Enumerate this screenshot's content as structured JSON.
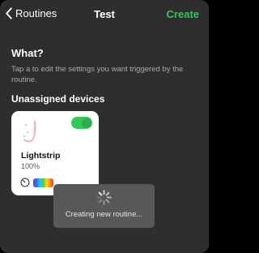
{
  "header": {
    "back_label": "Routines",
    "title": "Test",
    "create_label": "Create"
  },
  "what_section": {
    "heading": "What?",
    "description": "Tap a to edit the settings you want triggered by the routine."
  },
  "unassigned_section": {
    "heading": "Unassigned devices",
    "devices": [
      {
        "name": "Lightstrip",
        "level": "100%",
        "enabled": true,
        "icon": "lightstrip-icon"
      }
    ]
  },
  "overlay": {
    "message": "Creating new routine...",
    "icon": "spinner-icon"
  },
  "colors": {
    "accent": "#34c759",
    "background": "#2e2e2e",
    "card": "#ffffff",
    "toast": "#585858"
  }
}
